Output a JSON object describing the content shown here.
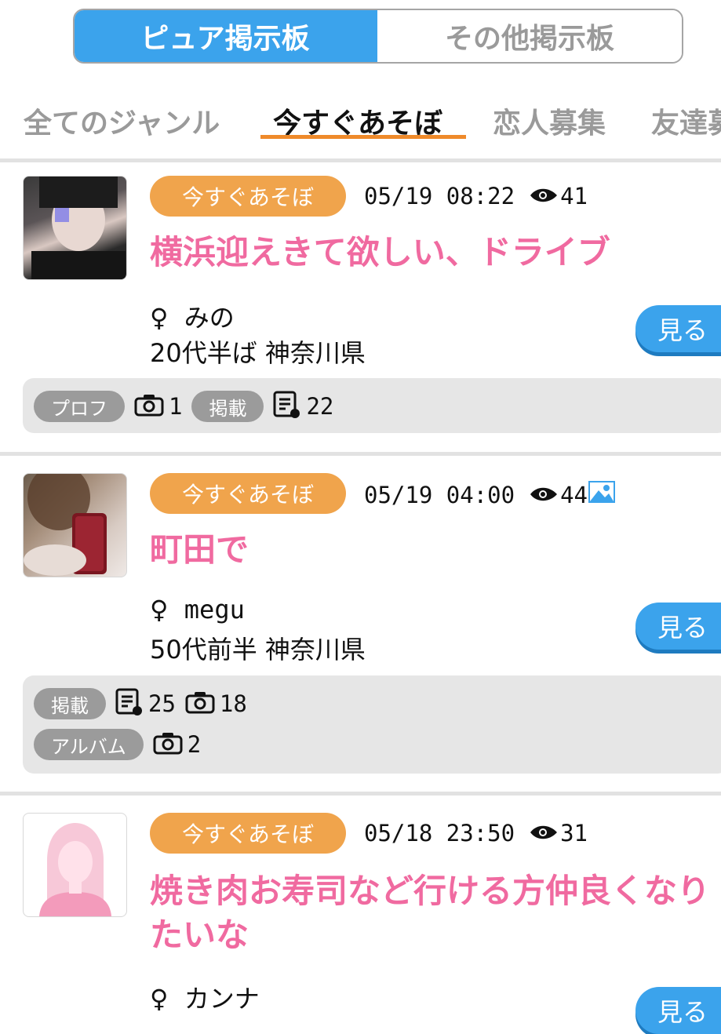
{
  "toggle": {
    "pure_label": "ピュア掲示板",
    "other_label": "その他掲示板"
  },
  "tabs": [
    {
      "label": "全てのジャンル"
    },
    {
      "label": "今すぐあそぼ"
    },
    {
      "label": "恋人募集"
    },
    {
      "label": "友達募"
    }
  ],
  "posts": [
    {
      "genre": "今すぐあそぼ",
      "datetime": "05/19 08:22",
      "views": "41",
      "title": "横浜迎えきて欲しい、ドライブ",
      "gender": "♀",
      "name": "みの",
      "age_area": "20代半ば  神奈川県",
      "see_label": "見る",
      "stats": {
        "line1": [
          {
            "pill": "プロフ",
            "icon": "camera-icon",
            "value": "1"
          },
          {
            "pill": "掲載",
            "icon": "post-history-icon",
            "value": "22"
          }
        ]
      }
    },
    {
      "genre": "今すぐあそぼ",
      "datetime": "05/19 04:00",
      "views": "44",
      "title": "町田で",
      "gender": "♀",
      "name": "megu",
      "age_area": "50代前半  神奈川県",
      "see_label": "見る",
      "stats": {
        "line1": [
          {
            "pill": "掲載",
            "icon": "post-history-icon",
            "value": "25"
          },
          {
            "pill": "",
            "icon": "camera-icon",
            "value": "18"
          }
        ],
        "line2": [
          {
            "pill": "アルバム",
            "icon": "camera-icon",
            "value": "2"
          }
        ]
      }
    },
    {
      "genre": "今すぐあそぼ",
      "datetime": "05/18 23:50",
      "views": "31",
      "title": "焼き肉お寿司など行ける方仲良くなりたいな",
      "gender": "♀",
      "name": "カンナ",
      "see_label": "見る"
    }
  ],
  "colors": {
    "accent_blue": "#3ba3ec",
    "genre_orange": "#f0a44c",
    "title_pink": "#f06aa0",
    "tab_underline": "#ef8a2a"
  }
}
